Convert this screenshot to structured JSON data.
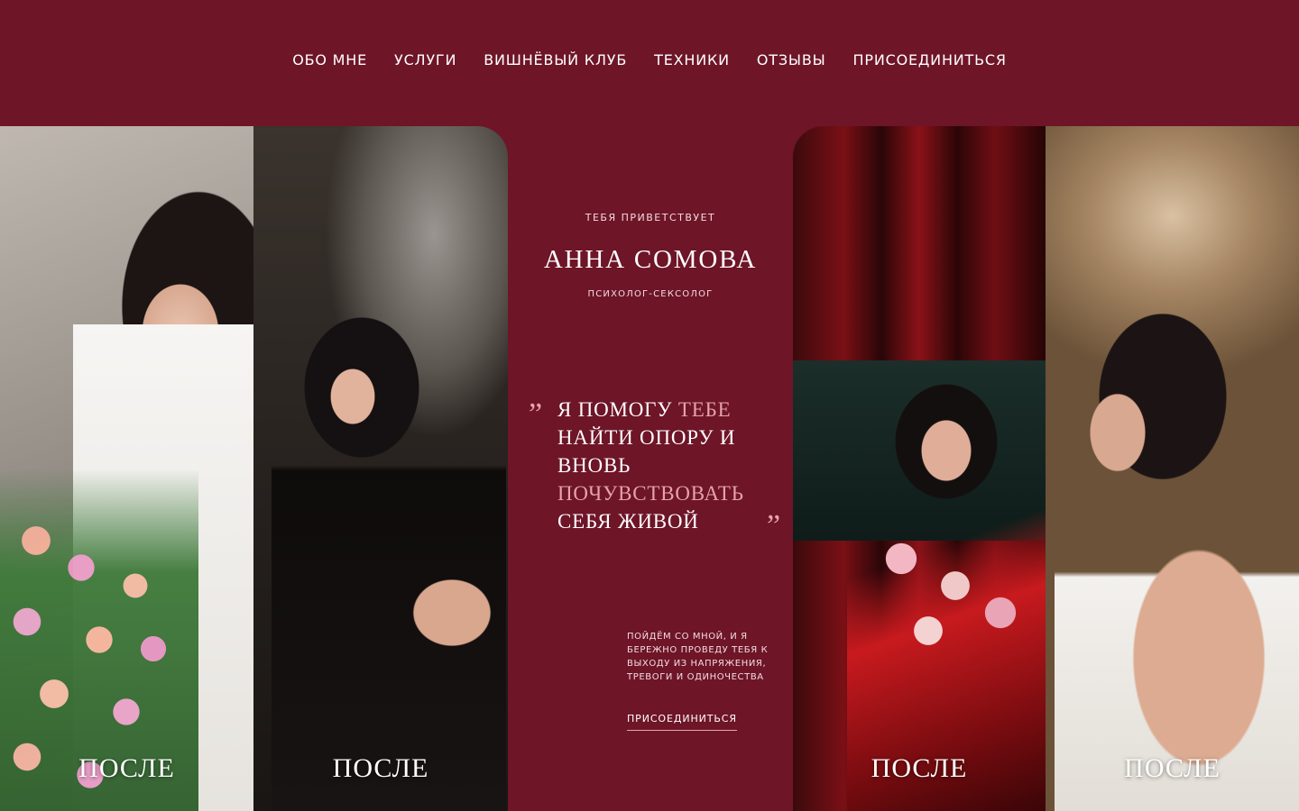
{
  "nav": {
    "items": [
      "ОБО МНЕ",
      "УСЛУГИ",
      "ВИШНЁВЫЙ КЛУБ",
      "ТЕХНИКИ",
      "ОТЗЫВЫ",
      "ПРИСОЕДИНИТЬСЯ"
    ]
  },
  "hero": {
    "greeting": "ТЕБЯ ПРИВЕТСТВУЕТ",
    "name": "АННА СОМОВА",
    "profession": "ПСИХОЛОГ-СЕКСОЛОГ",
    "quote_mark_open": "”",
    "quote_mark_close": "”",
    "quote": {
      "part1": "Я ПОМОГУ ",
      "part2": "ТЕБЕ",
      "part3": " НАЙТИ ОПОРУ И ВНОВЬ ",
      "part4": "ПОЧУВСТВОВАТЬ",
      "part5": " СЕБЯ ЖИВОЙ"
    },
    "lead": "ПОЙДЁМ СО МНОЙ, И Я БЕРЕЖНО ПРОВЕДУ ТЕБЯ К ВЫХОДУ ИЗ НАПРЯЖЕНИЯ, ТРЕВОГИ И ОДИНОЧЕСТВА",
    "cta": "ПРИСОЕДИНИТЬСЯ"
  },
  "photos": {
    "captions": [
      "ПОСЛЕ",
      "ПОСЛЕ",
      "ПОСЛЕ",
      "ПОСЛЕ"
    ]
  },
  "colors": {
    "background": "#6e1528",
    "accent": "#e5a2ad"
  }
}
